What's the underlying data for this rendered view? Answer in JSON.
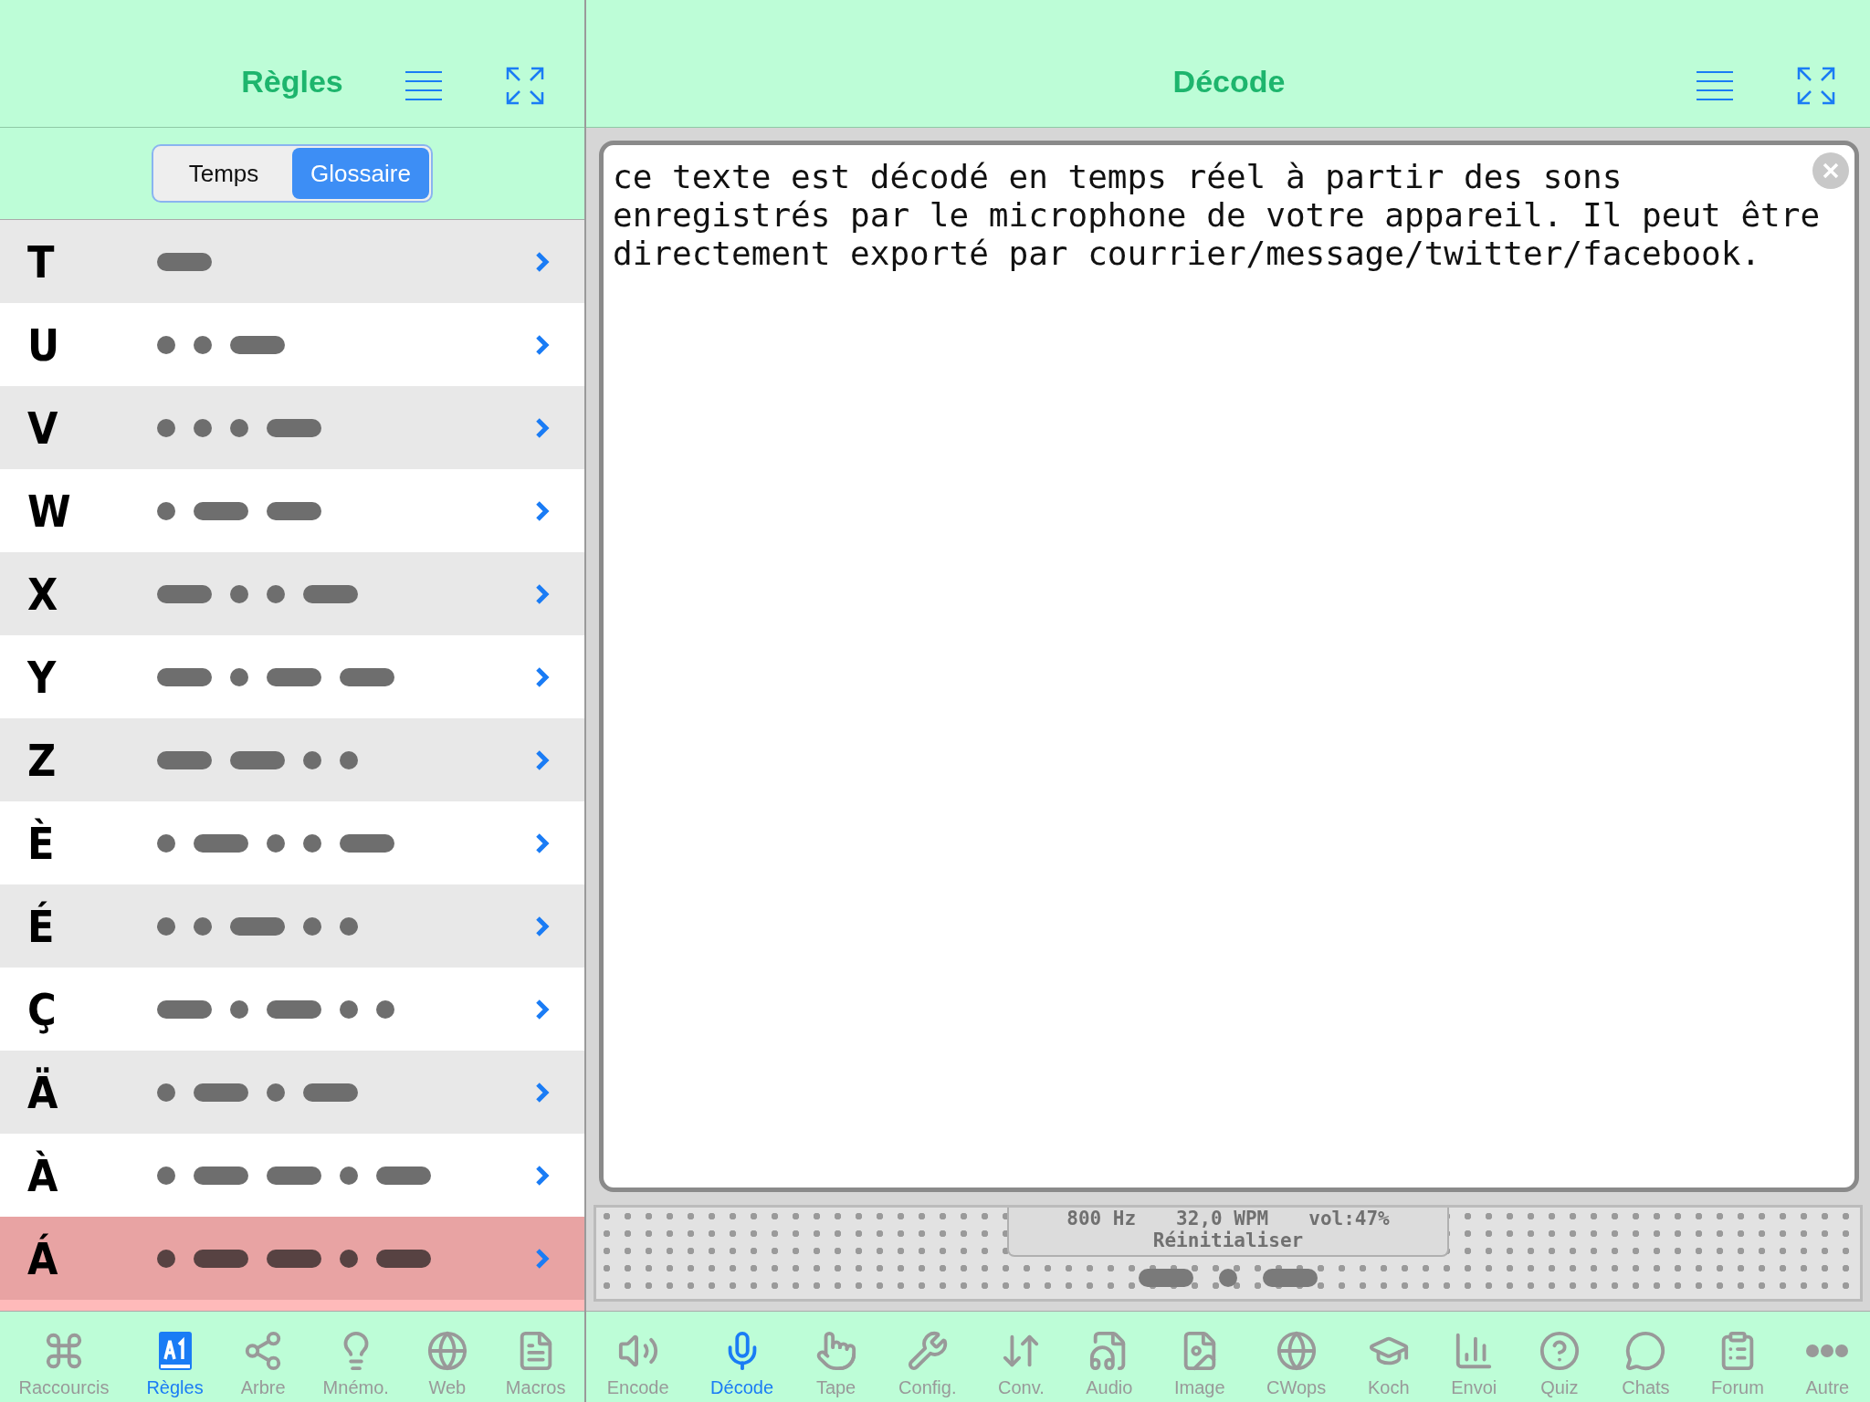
{
  "left_pane": {
    "title": "Règles",
    "segments": [
      {
        "label": "Temps",
        "selected": false
      },
      {
        "label": "Glossaire",
        "selected": true
      }
    ],
    "rows": [
      {
        "letter": "T",
        "signals": [
          {
            "kind": "dash"
          }
        ],
        "selected": false
      },
      {
        "letter": "U",
        "signals": [
          {
            "kind": "dot"
          },
          {
            "kind": "dot"
          },
          {
            "kind": "dash"
          }
        ],
        "selected": false
      },
      {
        "letter": "V",
        "signals": [
          {
            "kind": "dot"
          },
          {
            "kind": "dot"
          },
          {
            "kind": "dot"
          },
          {
            "kind": "dash"
          }
        ],
        "selected": false
      },
      {
        "letter": "W",
        "signals": [
          {
            "kind": "dot"
          },
          {
            "kind": "dash"
          },
          {
            "kind": "dash"
          }
        ],
        "selected": false
      },
      {
        "letter": "X",
        "signals": [
          {
            "kind": "dash"
          },
          {
            "kind": "dot"
          },
          {
            "kind": "dot"
          },
          {
            "kind": "dash"
          }
        ],
        "selected": false
      },
      {
        "letter": "Y",
        "signals": [
          {
            "kind": "dash"
          },
          {
            "kind": "dot"
          },
          {
            "kind": "dash"
          },
          {
            "kind": "dash"
          }
        ],
        "selected": false
      },
      {
        "letter": "Z",
        "signals": [
          {
            "kind": "dash"
          },
          {
            "kind": "dash"
          },
          {
            "kind": "dot"
          },
          {
            "kind": "dot"
          }
        ],
        "selected": false
      },
      {
        "letter": "È",
        "signals": [
          {
            "kind": "dot"
          },
          {
            "kind": "dash"
          },
          {
            "kind": "dot"
          },
          {
            "kind": "dot"
          },
          {
            "kind": "dash"
          }
        ],
        "selected": false
      },
      {
        "letter": "É",
        "signals": [
          {
            "kind": "dot"
          },
          {
            "kind": "dot"
          },
          {
            "kind": "dash"
          },
          {
            "kind": "dot"
          },
          {
            "kind": "dot"
          }
        ],
        "selected": false
      },
      {
        "letter": "Ç",
        "signals": [
          {
            "kind": "dash"
          },
          {
            "kind": "dot"
          },
          {
            "kind": "dash"
          },
          {
            "kind": "dot"
          },
          {
            "kind": "dot"
          }
        ],
        "selected": false
      },
      {
        "letter": "Ä",
        "signals": [
          {
            "kind": "dot"
          },
          {
            "kind": "dash"
          },
          {
            "kind": "dot"
          },
          {
            "kind": "dash"
          }
        ],
        "selected": false
      },
      {
        "letter": "À",
        "signals": [
          {
            "kind": "dot"
          },
          {
            "kind": "dash"
          },
          {
            "kind": "dash"
          },
          {
            "kind": "dot"
          },
          {
            "kind": "dash"
          }
        ],
        "selected": false
      },
      {
        "letter": "Á",
        "signals": [
          {
            "kind": "dot"
          },
          {
            "kind": "dash"
          },
          {
            "kind": "dash"
          },
          {
            "kind": "dot"
          },
          {
            "kind": "dash"
          }
        ],
        "selected": true
      }
    ],
    "tab_bar": [
      {
        "label": "Raccourcis",
        "selected": false
      },
      {
        "label": "Règles",
        "selected": true
      },
      {
        "label": "Arbre",
        "selected": false
      },
      {
        "label": "Mnémo.",
        "selected": false
      },
      {
        "label": "Web",
        "selected": false
      },
      {
        "label": "Macros",
        "selected": false
      }
    ]
  },
  "right_pane": {
    "title": "Décode",
    "decoded_text": "ce texte est décodé en temps réel à partir des sons enregistrés par le microphone de votre appareil. Il peut être directement exporté par courrier/message/twitter/facebook.",
    "readout": {
      "frequency": "800 Hz",
      "speed": "32,0 WPM",
      "volume": "vol:47%",
      "reset": "Réinitialiser"
    },
    "tab_bar": [
      {
        "label": "Encode",
        "selected": false
      },
      {
        "label": "Décode",
        "selected": true
      },
      {
        "label": "Tape",
        "selected": false
      },
      {
        "label": "Config.",
        "selected": false
      },
      {
        "label": "Conv.",
        "selected": false
      },
      {
        "label": "Audio",
        "selected": false
      },
      {
        "label": "Image",
        "selected": false
      },
      {
        "label": "CWops",
        "selected": false
      },
      {
        "label": "Koch",
        "selected": false
      },
      {
        "label": "Envoi",
        "selected": false
      },
      {
        "label": "Quiz",
        "selected": false
      },
      {
        "label": "Chats",
        "selected": false
      },
      {
        "label": "Forum",
        "selected": false
      },
      {
        "label": "Autre",
        "selected": false
      }
    ]
  }
}
